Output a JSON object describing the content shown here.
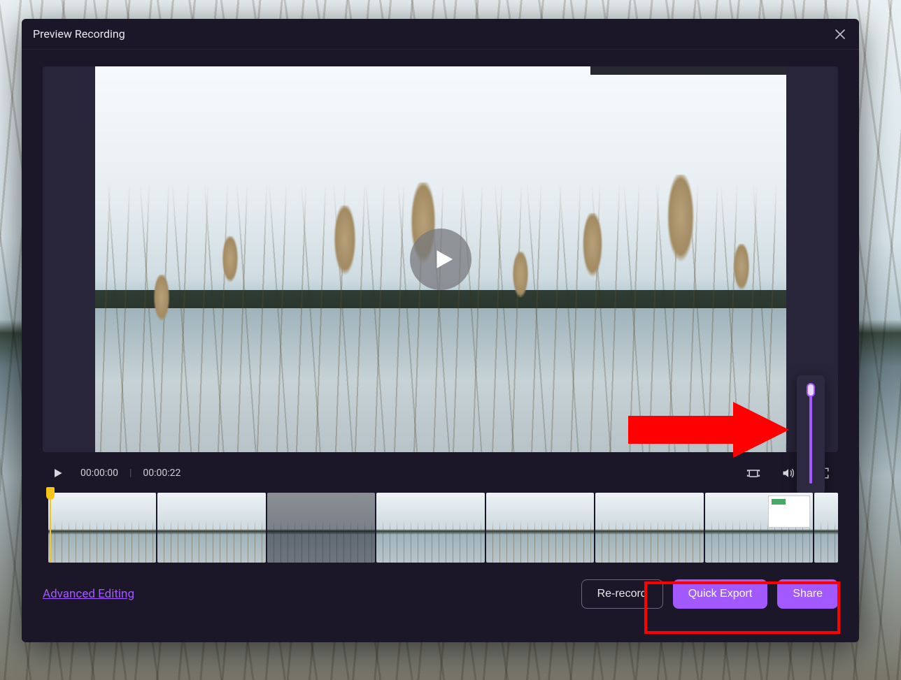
{
  "window": {
    "title": "Preview Recording"
  },
  "playback": {
    "current_time": "00:00:00",
    "total_time": "00:00:22",
    "playing": false,
    "volume_percent": 100
  },
  "timeline": {
    "thumbnail_count": 8,
    "dim_index": 2,
    "overlay_ui_index": 6,
    "playhead_position_percent": 0
  },
  "footer": {
    "advanced_link": "Advanced Editing",
    "re_record": "Re-record",
    "quick_export": "Quick Export",
    "share": "Share"
  },
  "icons": {
    "close": "close-icon",
    "play_small": "play-icon",
    "play_overlay": "play-circle-icon",
    "snapshot": "snapshot-icon",
    "volume": "volume-icon",
    "fullscreen": "fullscreen-icon"
  },
  "annotations": {
    "arrow_target": "volume-slider",
    "highlight_box_targets": [
      "quick-export-button",
      "share-button"
    ]
  },
  "colors": {
    "accent": "#a259ff",
    "dialog_bg": "#1c1728",
    "annotation": "#ff0000",
    "marker": "#f5c518"
  }
}
